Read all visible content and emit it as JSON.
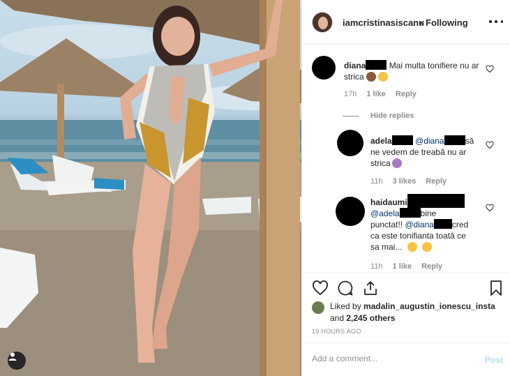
{
  "header": {
    "username": "iamcristinasiscanu",
    "dot": "•",
    "follow_status": "Following"
  },
  "comments": [
    {
      "username": "diana",
      "text": "Mai multa tonifiere nu ar strica",
      "time": "17h",
      "likes": "1 like",
      "reply": "Reply"
    }
  ],
  "hide_replies": "Hide replies",
  "replies": [
    {
      "username": "adela",
      "mention": "@diana",
      "text_a": "să",
      "text_b": "ne vedem de treabă nu ar",
      "text_c": "strica",
      "time": "11h",
      "likes": "3 likes",
      "reply": "Reply"
    },
    {
      "username": "haidaumi",
      "mention1": "@adela",
      "text_a": "bine",
      "text_b": "punctat!!",
      "mention2": "@diana",
      "text_c": "cred",
      "text_d": "ca este tonifianta toată ce",
      "text_e": "sa mai...",
      "time": "11h",
      "likes": "1 like",
      "reply": "Reply"
    }
  ],
  "likes": {
    "prefix": "Liked by",
    "user": "madalin_augustin_ionescu_insta",
    "and": "and",
    "others": "2,245 others"
  },
  "timestamp": "19 HOURS AGO",
  "add_comment": {
    "placeholder": "Add a comment...",
    "post_label": "Post"
  },
  "icons": [
    "heart-icon",
    "comment-icon",
    "share-icon",
    "bookmark-icon",
    "more-icon",
    "user-tag-icon"
  ],
  "colors": {
    "mention": "#003569",
    "muted": "#8e8e8e",
    "post_disabled": "#b2dffc",
    "redaction": "#000000"
  }
}
